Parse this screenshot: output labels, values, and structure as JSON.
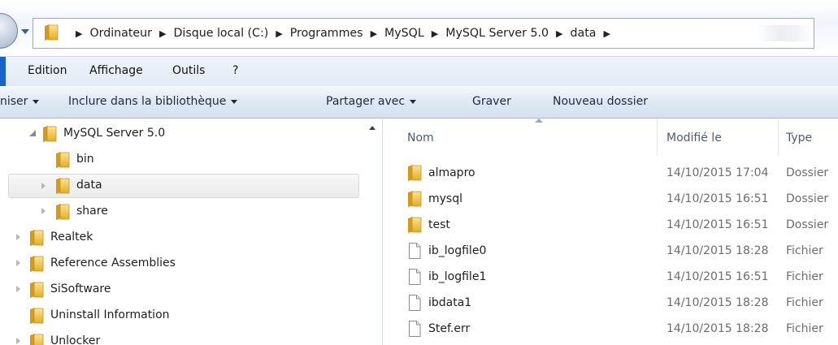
{
  "address_bar": {
    "breadcrumbs": [
      "Ordinateur",
      "Disque local (C:)",
      "Programmes",
      "MySQL",
      "MySQL Server 5.0",
      "data"
    ]
  },
  "menu": {
    "items": [
      "Edition",
      "Affichage",
      "Outils",
      "?"
    ]
  },
  "toolbar": {
    "organize_label": "niser",
    "include_label": "Inclure dans la bibliothèque",
    "share_label": "Partager avec",
    "burn_label": "Graver",
    "new_folder_label": "Nouveau dossier"
  },
  "nav_tree": {
    "items": [
      {
        "label": "MySQL Server 5.0",
        "state": "expanded"
      },
      {
        "label": "bin",
        "state": "leaf"
      },
      {
        "label": "data",
        "state": "collapsed",
        "selected": true
      },
      {
        "label": "share",
        "state": "collapsed"
      },
      {
        "label": "Realtek",
        "state": "collapsed"
      },
      {
        "label": "Reference Assemblies",
        "state": "collapsed"
      },
      {
        "label": "SiSoftware",
        "state": "collapsed"
      },
      {
        "label": "Uninstall Information",
        "state": "leaf"
      },
      {
        "label": "Unlocker",
        "state": "collapsed"
      }
    ]
  },
  "file_list": {
    "columns": [
      "Nom",
      "Modifié le",
      "Type"
    ],
    "rows": [
      {
        "name": "almapro",
        "modified": "14/10/2015 17:04",
        "type": "Dossier",
        "icon": "folder-icon"
      },
      {
        "name": "mysql",
        "modified": "14/10/2015 16:51",
        "type": "Dossier",
        "icon": "folder-icon"
      },
      {
        "name": "test",
        "modified": "14/10/2015 16:51",
        "type": "Dossier",
        "icon": "folder-icon"
      },
      {
        "name": "ib_logfile0",
        "modified": "14/10/2015 18:28",
        "type": "Fichier",
        "icon": "file-icon"
      },
      {
        "name": "ib_logfile1",
        "modified": "14/10/2015 16:51",
        "type": "Fichier",
        "icon": "file-icon"
      },
      {
        "name": "ibdata1",
        "modified": "14/10/2015 18:28",
        "type": "Fichier",
        "icon": "file-icon"
      },
      {
        "name": "Stef.err",
        "modified": "14/10/2015 18:28",
        "type": "Fichier",
        "icon": "file-icon"
      }
    ]
  },
  "colors": {
    "folder": "#e8b92e",
    "accent": "#1a63c6",
    "header_text": "#4a5b74",
    "secondary_text": "#6d6d6d"
  }
}
